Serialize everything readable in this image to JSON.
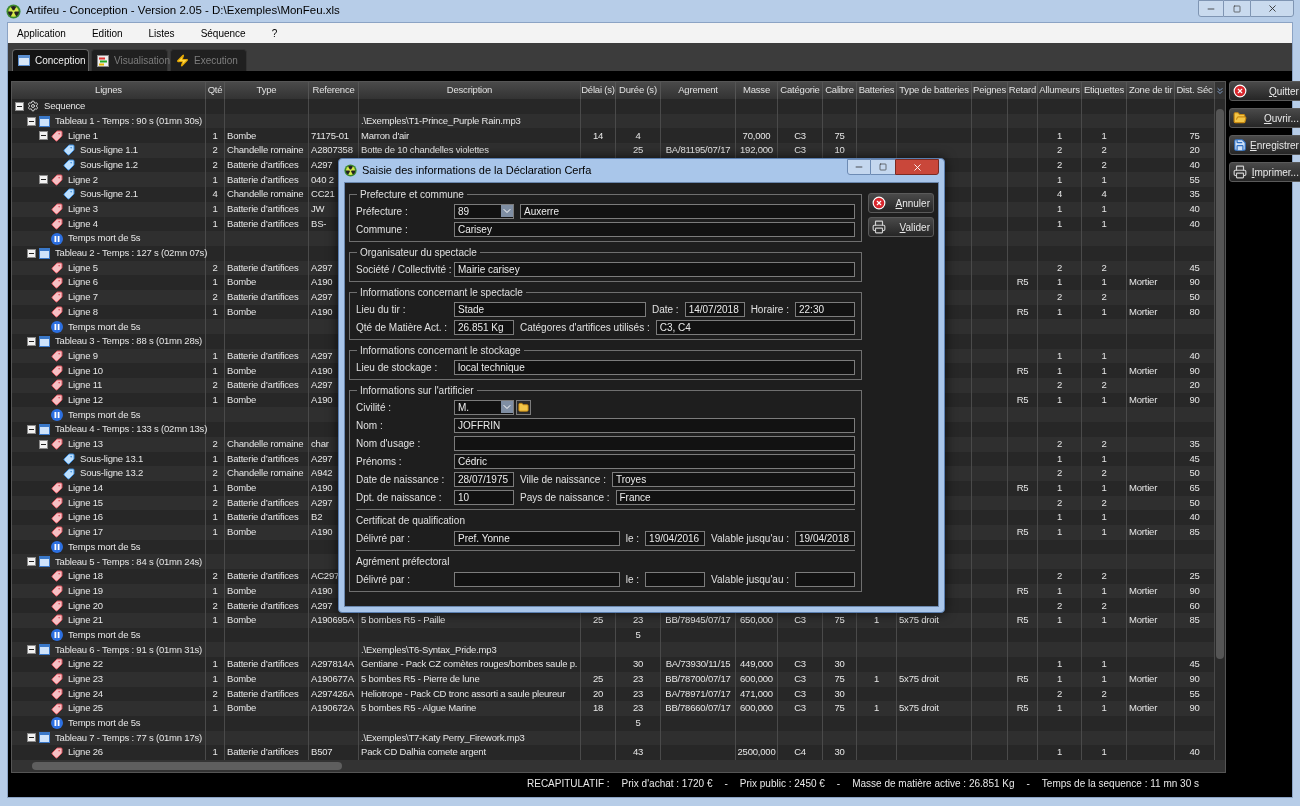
{
  "window": {
    "title": "Artifeu - Conception - Version 2.05 - D:\\Exemples\\MonFeu.xls"
  },
  "menu": [
    "Application",
    "Edition",
    "Listes",
    "Séquence",
    "?"
  ],
  "tabs": [
    {
      "label": "Conception",
      "selected": true,
      "kind": "design"
    },
    {
      "label": "Visualisation",
      "selected": false,
      "kind": "view"
    },
    {
      "label": "Execution",
      "selected": false,
      "kind": "run"
    }
  ],
  "table": {
    "columns": [
      "Lignes",
      "Qté",
      "Type",
      "Reference",
      "Description",
      "Délai (s)",
      "Durée (s)",
      "Agrement",
      "Masse",
      "Catégorie",
      "Calibre",
      "Batteries",
      "Type de batteries",
      "Peignes",
      "Retard",
      "Allumeurs",
      "Etiquettes",
      "Zone de tir",
      "Dist. Séc"
    ],
    "rows": [
      {
        "label": "Sequence",
        "kind": "sequence",
        "expanded": true,
        "children": [
          {
            "label": "Tableau 1 - Temps : 90 s (01mn 30s)",
            "kind": "tableau",
            "expanded": true,
            "cells": [
              null,
              null,
              null,
              ".\\Exemples\\T1-Prince_Purple Rain.mp3"
            ],
            "children": [
              {
                "label": "Ligne 1",
                "kind": "ligne",
                "expanded": true,
                "cells": [
                  "1",
                  "Bombe",
                  "71175-01",
                  "Marron d'air",
                  "14",
                  "4",
                  null,
                  "70,000",
                  "C3",
                  "75",
                  null,
                  null,
                  null,
                  null,
                  "1",
                  "1",
                  null,
                  "75"
                ],
                "children": [
                  {
                    "label": "Sous-ligne 1.1",
                    "kind": "sous-ligne",
                    "cells": [
                      "2",
                      "Chandelle romaine",
                      "A2807358",
                      "Botte de 10 chandelles violettes",
                      null,
                      "25",
                      "BA/81195/07/17",
                      "192,000",
                      "C3",
                      "10",
                      null,
                      null,
                      null,
                      null,
                      "2",
                      "2",
                      null,
                      "20"
                    ]
                  },
                  {
                    "label": "Sous-ligne 1.2",
                    "kind": "sous-ligne",
                    "cells": [
                      "2",
                      "Batterie d’artifices",
                      "A297",
                      null,
                      null,
                      null,
                      null,
                      null,
                      null,
                      null,
                      null,
                      null,
                      null,
                      null,
                      "2",
                      "2",
                      null,
                      "40"
                    ]
                  }
                ]
              },
              {
                "label": "Ligne 2",
                "kind": "ligne",
                "expanded": true,
                "cells": [
                  "1",
                  "Batterie d’artifices",
                  "040 2",
                  null,
                  null,
                  null,
                  null,
                  null,
                  null,
                  null,
                  null,
                  null,
                  null,
                  null,
                  "1",
                  "1",
                  null,
                  "55"
                ],
                "children": [
                  {
                    "label": "Sous-ligne 2.1",
                    "kind": "sous-ligne",
                    "cells": [
                      "4",
                      "Chandelle romaine",
                      "CC21",
                      null,
                      null,
                      null,
                      null,
                      null,
                      null,
                      null,
                      null,
                      null,
                      null,
                      null,
                      "4",
                      "4",
                      null,
                      "35"
                    ]
                  }
                ]
              },
              {
                "label": "Ligne 3",
                "kind": "ligne",
                "cells": [
                  "1",
                  "Batterie d’artifices",
                  "JW",
                  null,
                  null,
                  null,
                  null,
                  null,
                  null,
                  null,
                  null,
                  null,
                  null,
                  null,
                  "1",
                  "1",
                  null,
                  "40"
                ]
              },
              {
                "label": "Ligne 4",
                "kind": "ligne",
                "cells": [
                  "1",
                  "Batterie d’artifices",
                  "BS-",
                  null,
                  null,
                  null,
                  null,
                  null,
                  null,
                  null,
                  null,
                  null,
                  null,
                  null,
                  "1",
                  "1",
                  null,
                  "40"
                ]
              },
              {
                "label": "Temps mort de 5s",
                "kind": "pause"
              }
            ]
          },
          {
            "label": "Tableau 2 - Temps : 127 s (02mn 07s)",
            "kind": "tableau",
            "expanded": true,
            "children": [
              {
                "label": "Ligne 5",
                "kind": "ligne",
                "cells": [
                  "2",
                  "Batterie d’artifices",
                  "A297",
                  null,
                  null,
                  null,
                  null,
                  null,
                  null,
                  null,
                  null,
                  null,
                  null,
                  null,
                  "2",
                  "2",
                  null,
                  "45"
                ]
              },
              {
                "label": "Ligne 6",
                "kind": "ligne",
                "cells": [
                  "1",
                  "Bombe",
                  "A190",
                  null,
                  null,
                  null,
                  null,
                  null,
                  null,
                  null,
                  null,
                  null,
                  null,
                  "R5",
                  "1",
                  "1",
                  "Mortier",
                  "90"
                ]
              },
              {
                "label": "Ligne 7",
                "kind": "ligne",
                "cells": [
                  "2",
                  "Batterie d’artifices",
                  "A297",
                  null,
                  null,
                  null,
                  null,
                  null,
                  null,
                  null,
                  null,
                  null,
                  null,
                  null,
                  "2",
                  "2",
                  null,
                  "50"
                ]
              },
              {
                "label": "Ligne 8",
                "kind": "ligne",
                "cells": [
                  "1",
                  "Bombe",
                  "A190",
                  null,
                  null,
                  null,
                  null,
                  null,
                  null,
                  null,
                  null,
                  null,
                  null,
                  "R5",
                  "1",
                  "1",
                  "Mortier",
                  "80"
                ]
              },
              {
                "label": "Temps mort de 5s",
                "kind": "pause"
              }
            ]
          },
          {
            "label": "Tableau 3 - Temps : 88 s (01mn 28s)",
            "kind": "tableau",
            "expanded": true,
            "children": [
              {
                "label": "Ligne 9",
                "kind": "ligne",
                "cells": [
                  "1",
                  "Batterie d’artifices",
                  "A297",
                  null,
                  null,
                  null,
                  null,
                  null,
                  null,
                  null,
                  null,
                  null,
                  null,
                  null,
                  "1",
                  "1",
                  null,
                  "40"
                ]
              },
              {
                "label": "Ligne 10",
                "kind": "ligne",
                "cells": [
                  "1",
                  "Bombe",
                  "A190",
                  null,
                  null,
                  null,
                  null,
                  null,
                  null,
                  null,
                  null,
                  null,
                  null,
                  "R5",
                  "1",
                  "1",
                  "Mortier",
                  "90"
                ]
              },
              {
                "label": "Ligne 11",
                "kind": "ligne",
                "cells": [
                  "2",
                  "Batterie d’artifices",
                  "A297",
                  null,
                  null,
                  null,
                  null,
                  null,
                  null,
                  null,
                  null,
                  null,
                  null,
                  null,
                  "2",
                  "2",
                  null,
                  "20"
                ]
              },
              {
                "label": "Ligne 12",
                "kind": "ligne",
                "cells": [
                  "1",
                  "Bombe",
                  "A190",
                  null,
                  null,
                  null,
                  null,
                  null,
                  null,
                  null,
                  null,
                  null,
                  null,
                  "R5",
                  "1",
                  "1",
                  "Mortier",
                  "90"
                ]
              },
              {
                "label": "Temps mort de 5s",
                "kind": "pause"
              }
            ]
          },
          {
            "label": "Tableau 4 - Temps : 133 s (02mn 13s)",
            "kind": "tableau",
            "expanded": true,
            "children": [
              {
                "label": "Ligne 13",
                "kind": "ligne",
                "expanded": true,
                "cells": [
                  "2",
                  "Chandelle romaine",
                  "char",
                  null,
                  null,
                  null,
                  null,
                  null,
                  null,
                  null,
                  null,
                  null,
                  null,
                  null,
                  "2",
                  "2",
                  null,
                  "35"
                ],
                "children": [
                  {
                    "label": "Sous-ligne 13.1",
                    "kind": "sous-ligne",
                    "cells": [
                      "1",
                      "Batterie d’artifices",
                      "A297",
                      null,
                      null,
                      null,
                      null,
                      null,
                      null,
                      null,
                      null,
                      null,
                      null,
                      null,
                      "1",
                      "1",
                      null,
                      "45"
                    ]
                  },
                  {
                    "label": "Sous-ligne 13.2",
                    "kind": "sous-ligne",
                    "cells": [
                      "2",
                      "Chandelle romaine",
                      "A942",
                      null,
                      null,
                      null,
                      null,
                      null,
                      null,
                      null,
                      null,
                      null,
                      null,
                      null,
                      "2",
                      "2",
                      null,
                      "50"
                    ]
                  }
                ]
              },
              {
                "label": "Ligne 14",
                "kind": "ligne",
                "cells": [
                  "1",
                  "Bombe",
                  "A190",
                  null,
                  null,
                  null,
                  null,
                  null,
                  null,
                  null,
                  null,
                  null,
                  null,
                  "R5",
                  "1",
                  "1",
                  "Mortier",
                  "65"
                ]
              },
              {
                "label": "Ligne 15",
                "kind": "ligne",
                "cells": [
                  "2",
                  "Batterie d’artifices",
                  "A297",
                  null,
                  null,
                  null,
                  null,
                  null,
                  null,
                  null,
                  null,
                  null,
                  null,
                  null,
                  "2",
                  "2",
                  null,
                  "50"
                ]
              },
              {
                "label": "Ligne 16",
                "kind": "ligne",
                "cells": [
                  "1",
                  "Batterie d’artifices",
                  "B2",
                  null,
                  null,
                  null,
                  null,
                  null,
                  null,
                  null,
                  null,
                  null,
                  null,
                  null,
                  "1",
                  "1",
                  null,
                  "40"
                ]
              },
              {
                "label": "Ligne 17",
                "kind": "ligne",
                "cells": [
                  "1",
                  "Bombe",
                  "A190",
                  null,
                  null,
                  null,
                  null,
                  null,
                  null,
                  null,
                  null,
                  null,
                  null,
                  "R5",
                  "1",
                  "1",
                  "Mortier",
                  "85"
                ]
              },
              {
                "label": "Temps mort de 5s",
                "kind": "pause"
              }
            ]
          },
          {
            "label": "Tableau 5 - Temps : 84 s (01mn 24s)",
            "kind": "tableau",
            "expanded": true,
            "children": [
              {
                "label": "Ligne 18",
                "kind": "ligne",
                "cells": [
                  "2",
                  "Batterie d’artifices",
                  "AC297",
                  null,
                  null,
                  null,
                  null,
                  null,
                  null,
                  null,
                  null,
                  null,
                  null,
                  null,
                  "2",
                  "2",
                  null,
                  "25"
                ]
              },
              {
                "label": "Ligne 19",
                "kind": "ligne",
                "cells": [
                  "1",
                  "Bombe",
                  "A190",
                  null,
                  null,
                  null,
                  null,
                  null,
                  null,
                  null,
                  null,
                  null,
                  null,
                  "R5",
                  "1",
                  "1",
                  "Mortier",
                  "90"
                ]
              },
              {
                "label": "Ligne 20",
                "kind": "ligne",
                "cells": [
                  "2",
                  "Batterie d’artifices",
                  "A297",
                  null,
                  null,
                  null,
                  null,
                  null,
                  null,
                  null,
                  null,
                  null,
                  null,
                  null,
                  "2",
                  "2",
                  null,
                  "60"
                ]
              },
              {
                "label": "Ligne 21",
                "kind": "ligne",
                "cells": [
                  "1",
                  "Bombe",
                  "A190695A",
                  "5 bombes R5 - Paille",
                  "25",
                  "23",
                  "BB/78945/07/17",
                  "650,000",
                  "C3",
                  "75",
                  "1",
                  "5x75 droit",
                  null,
                  "R5",
                  "1",
                  "1",
                  "Mortier",
                  "85"
                ]
              },
              {
                "label": "Temps mort de 5s",
                "kind": "pause",
                "cells": [
                  null,
                  null,
                  null,
                  null,
                  null,
                  "5"
                ]
              }
            ]
          },
          {
            "label": "Tableau 6 - Temps : 91 s (01mn 31s)",
            "kind": "tableau",
            "expanded": true,
            "cells": [
              null,
              null,
              null,
              ".\\Exemples\\T6-Syntax_Pride.mp3"
            ],
            "children": [
              {
                "label": "Ligne 22",
                "kind": "ligne",
                "cells": [
                  "1",
                  "Batterie d’artifices",
                  "A297814A",
                  "Gentiane - Pack CZ comètes rouges/bombes saule p.",
                  null,
                  "30",
                  "BA/73930/11/15",
                  "449,000",
                  "C3",
                  "30",
                  null,
                  null,
                  null,
                  null,
                  "1",
                  "1",
                  null,
                  "45"
                ]
              },
              {
                "label": "Ligne 23",
                "kind": "ligne",
                "cells": [
                  "1",
                  "Bombe",
                  "A190677A",
                  "5 bombes R5 - Pierre de lune",
                  "25",
                  "23",
                  "BB/78700/07/17",
                  "600,000",
                  "C3",
                  "75",
                  "1",
                  "5x75 droit",
                  null,
                  "R5",
                  "1",
                  "1",
                  "Mortier",
                  "90"
                ]
              },
              {
                "label": "Ligne 24",
                "kind": "ligne",
                "cells": [
                  "2",
                  "Batterie d’artifices",
                  "A297426A",
                  "Heliotrope - Pack CD tronc assorti a saule pleureur",
                  "20",
                  "23",
                  "BA/78971/07/17",
                  "471,000",
                  "C3",
                  "30",
                  null,
                  null,
                  null,
                  null,
                  "2",
                  "2",
                  null,
                  "55"
                ]
              },
              {
                "label": "Ligne 25",
                "kind": "ligne",
                "cells": [
                  "1",
                  "Bombe",
                  "A190672A",
                  "5 bombes R5 - Algue Marine",
                  "18",
                  "23",
                  "BB/78660/07/17",
                  "600,000",
                  "C3",
                  "75",
                  "1",
                  "5x75 droit",
                  null,
                  "R5",
                  "1",
                  "1",
                  "Mortier",
                  "90"
                ]
              },
              {
                "label": "Temps mort de 5s",
                "kind": "pause",
                "cells": [
                  null,
                  null,
                  null,
                  null,
                  null,
                  "5"
                ]
              }
            ]
          },
          {
            "label": "Tableau 7 - Temps : 77 s (01mn 17s)",
            "kind": "tableau",
            "expanded": true,
            "cells": [
              null,
              null,
              null,
              ".\\Exemples\\T7-Katy Perry_Firework.mp3"
            ],
            "children": [
              {
                "label": "Ligne 26",
                "kind": "ligne",
                "cells": [
                  "1",
                  "Batterie d’artifices",
                  "B507",
                  "Pack CD Dalhia comete argent",
                  null,
                  "43",
                  null,
                  "2500,000",
                  "C4",
                  "30",
                  null,
                  null,
                  null,
                  null,
                  "1",
                  "1",
                  null,
                  "40"
                ]
              }
            ]
          }
        ]
      }
    ]
  },
  "actions": [
    {
      "label": "Quitter",
      "kind": "quit"
    },
    {
      "label": "Ouvrir...",
      "kind": "open"
    },
    {
      "label": "Enregistrer",
      "kind": "save"
    },
    {
      "label": "Imprimer...",
      "kind": "print"
    }
  ],
  "dialog": {
    "title": "Saisie des informations de la Déclaration Cerfa",
    "sections": [
      {
        "title": "Prefecture et commune",
        "rows": [
          {
            "kind": "fields",
            "fields": [
              {
                "label": "Préfecture :",
                "value": "89",
                "kind": "combo"
              },
              {
                "value": "Auxerre",
                "kind": "text"
              }
            ]
          },
          {
            "kind": "fields",
            "fields": [
              {
                "label": "Commune :",
                "value": "Carisey",
                "kind": "text"
              }
            ]
          }
        ]
      },
      {
        "title": "Organisateur du spectacle",
        "rows": [
          {
            "kind": "fields",
            "fields": [
              {
                "label": "Société / Collectivité :",
                "value": "Mairie carisey",
                "kind": "text"
              }
            ]
          }
        ]
      },
      {
        "title": "Informations concernant le spectacle",
        "rows": [
          {
            "kind": "fields",
            "fields": [
              {
                "label": "Lieu du tir :",
                "value": "Stade",
                "kind": "text"
              },
              {
                "label": "Date :",
                "value": "14/07/2018",
                "kind": "date"
              },
              {
                "label": "Horaire :",
                "value": "22:30",
                "kind": "date"
              }
            ]
          },
          {
            "kind": "fields",
            "fields": [
              {
                "label": "Qté de Matière Act. :",
                "value": "26.851 Kg",
                "kind": "date"
              },
              {
                "label": "Catégores d'artifices utilisés :",
                "value": "C3, C4",
                "kind": "text"
              }
            ]
          }
        ]
      },
      {
        "title": "Informations concernant le stockage",
        "rows": [
          {
            "kind": "fields",
            "fields": [
              {
                "label": "Lieu de stockage :",
                "value": "local technique",
                "kind": "text"
              }
            ]
          }
        ]
      },
      {
        "title": "Informations sur l'artificier",
        "rows": [
          {
            "kind": "fields",
            "fields": [
              {
                "label": "Civilité :",
                "value": "M.",
                "kind": "combo_folder"
              }
            ]
          },
          {
            "kind": "fields",
            "fields": [
              {
                "label": "Nom :",
                "value": "JOFFRIN",
                "kind": "text"
              }
            ]
          },
          {
            "kind": "fields",
            "fields": [
              {
                "label": "Nom d'usage :",
                "kind": "text"
              }
            ]
          },
          {
            "kind": "fields",
            "fields": [
              {
                "label": "Prénoms :",
                "value": "Cédric",
                "kind": "text"
              }
            ]
          },
          {
            "kind": "fields",
            "fields": [
              {
                "label": "Date de naissance :",
                "value": "28/07/1975",
                "kind": "date"
              },
              {
                "label": "Ville de naissance :",
                "value": "Troyes",
                "kind": "text"
              }
            ]
          },
          {
            "kind": "fields",
            "fields": [
              {
                "label": "Dpt. de naissance :",
                "value": "10",
                "kind": "date"
              },
              {
                "label": "Pays de naissance :",
                "value": "France",
                "kind": "text"
              }
            ]
          },
          {
            "kind": "heading",
            "text": "Certificat de qualification"
          },
          {
            "kind": "fields",
            "fields": [
              {
                "label": "Délivré par :",
                "value": "Pref. Yonne",
                "kind": "text"
              },
              {
                "label": "le :",
                "value": "19/04/2016",
                "kind": "date"
              },
              {
                "label": "Valable jusqu'au :",
                "value": "19/04/2018",
                "kind": "date"
              }
            ]
          },
          {
            "kind": "heading",
            "text": "Agrément préfectoral"
          },
          {
            "kind": "fields",
            "fields": [
              {
                "label": "Délivré par :",
                "kind": "text"
              },
              {
                "label": "le :",
                "kind": "date"
              },
              {
                "label": "Valable jusqu'au :",
                "kind": "date"
              }
            ]
          }
        ]
      }
    ],
    "buttons": [
      {
        "label": "Annuler",
        "kind": "cancel"
      },
      {
        "label": "Valider",
        "kind": "print"
      }
    ]
  },
  "status_bar": {
    "items": [
      "RECAPITULATIF :",
      "Prix d'achat : 1720 €",
      "-",
      "Prix public : 2450 €",
      "-",
      "Masse de matière active : 26.851 Kg",
      "-",
      "Temps de la sequence : 11 mn 30 s"
    ]
  }
}
